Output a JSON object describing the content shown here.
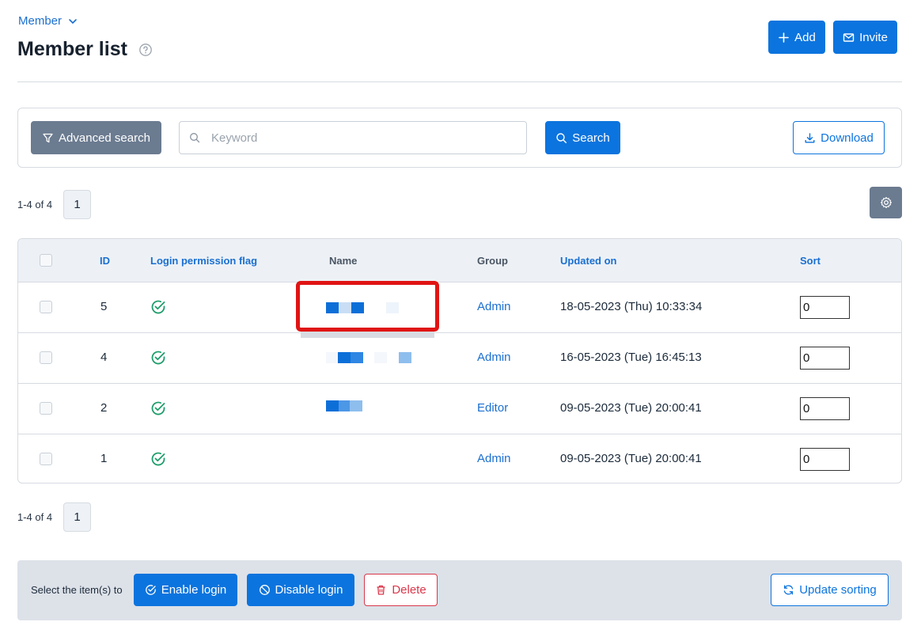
{
  "header": {
    "breadcrumb": "Member",
    "title": "Member list",
    "add_label": "Add",
    "invite_label": "Invite"
  },
  "search": {
    "advanced_label": "Advanced search",
    "keyword_placeholder": "Keyword",
    "keyword_value": "",
    "search_label": "Search",
    "download_label": "Download"
  },
  "pagination": {
    "range_text": "1-4 of 4",
    "pages": [
      "1"
    ]
  },
  "table": {
    "columns": {
      "id": "ID",
      "login_flag": "Login permission flag",
      "name": "Name",
      "group": "Group",
      "updated_on": "Updated on",
      "sort": "Sort"
    },
    "rows": [
      {
        "id": "5",
        "login_enabled": true,
        "group": "Admin",
        "updated_on": "18-05-2023 (Thu) 10:33:34",
        "sort": "0"
      },
      {
        "id": "4",
        "login_enabled": true,
        "group": "Admin",
        "updated_on": "16-05-2023 (Tue) 16:45:13",
        "sort": "0"
      },
      {
        "id": "2",
        "login_enabled": true,
        "group": "Editor",
        "updated_on": "09-05-2023 (Tue) 20:00:41",
        "sort": "0"
      },
      {
        "id": "1",
        "login_enabled": true,
        "group": "Admin",
        "updated_on": "09-05-2023 (Tue) 20:00:41",
        "sort": "0"
      }
    ]
  },
  "bulk": {
    "label": "Select the item(s) to",
    "enable_label": "Enable login",
    "disable_label": "Disable login",
    "delete_label": "Delete",
    "update_sorting_label": "Update sorting"
  },
  "colors": {
    "primary": "#0c74de",
    "gray_button": "#6b7b90",
    "danger": "#d9374a",
    "success": "#1f9d6b",
    "highlight": "#e01414"
  },
  "icons": {
    "breadcrumb": "chevron-down-icon",
    "help": "help-circle-icon",
    "add": "plus-icon",
    "invite": "mail-icon",
    "advanced": "filter-icon",
    "search": "search-icon",
    "download": "download-icon",
    "settings": "gear-icon",
    "login_flag": "check-circle-icon",
    "enable": "check-circle-icon",
    "disable": "ban-icon",
    "delete": "trash-icon",
    "update": "refresh-icon"
  }
}
